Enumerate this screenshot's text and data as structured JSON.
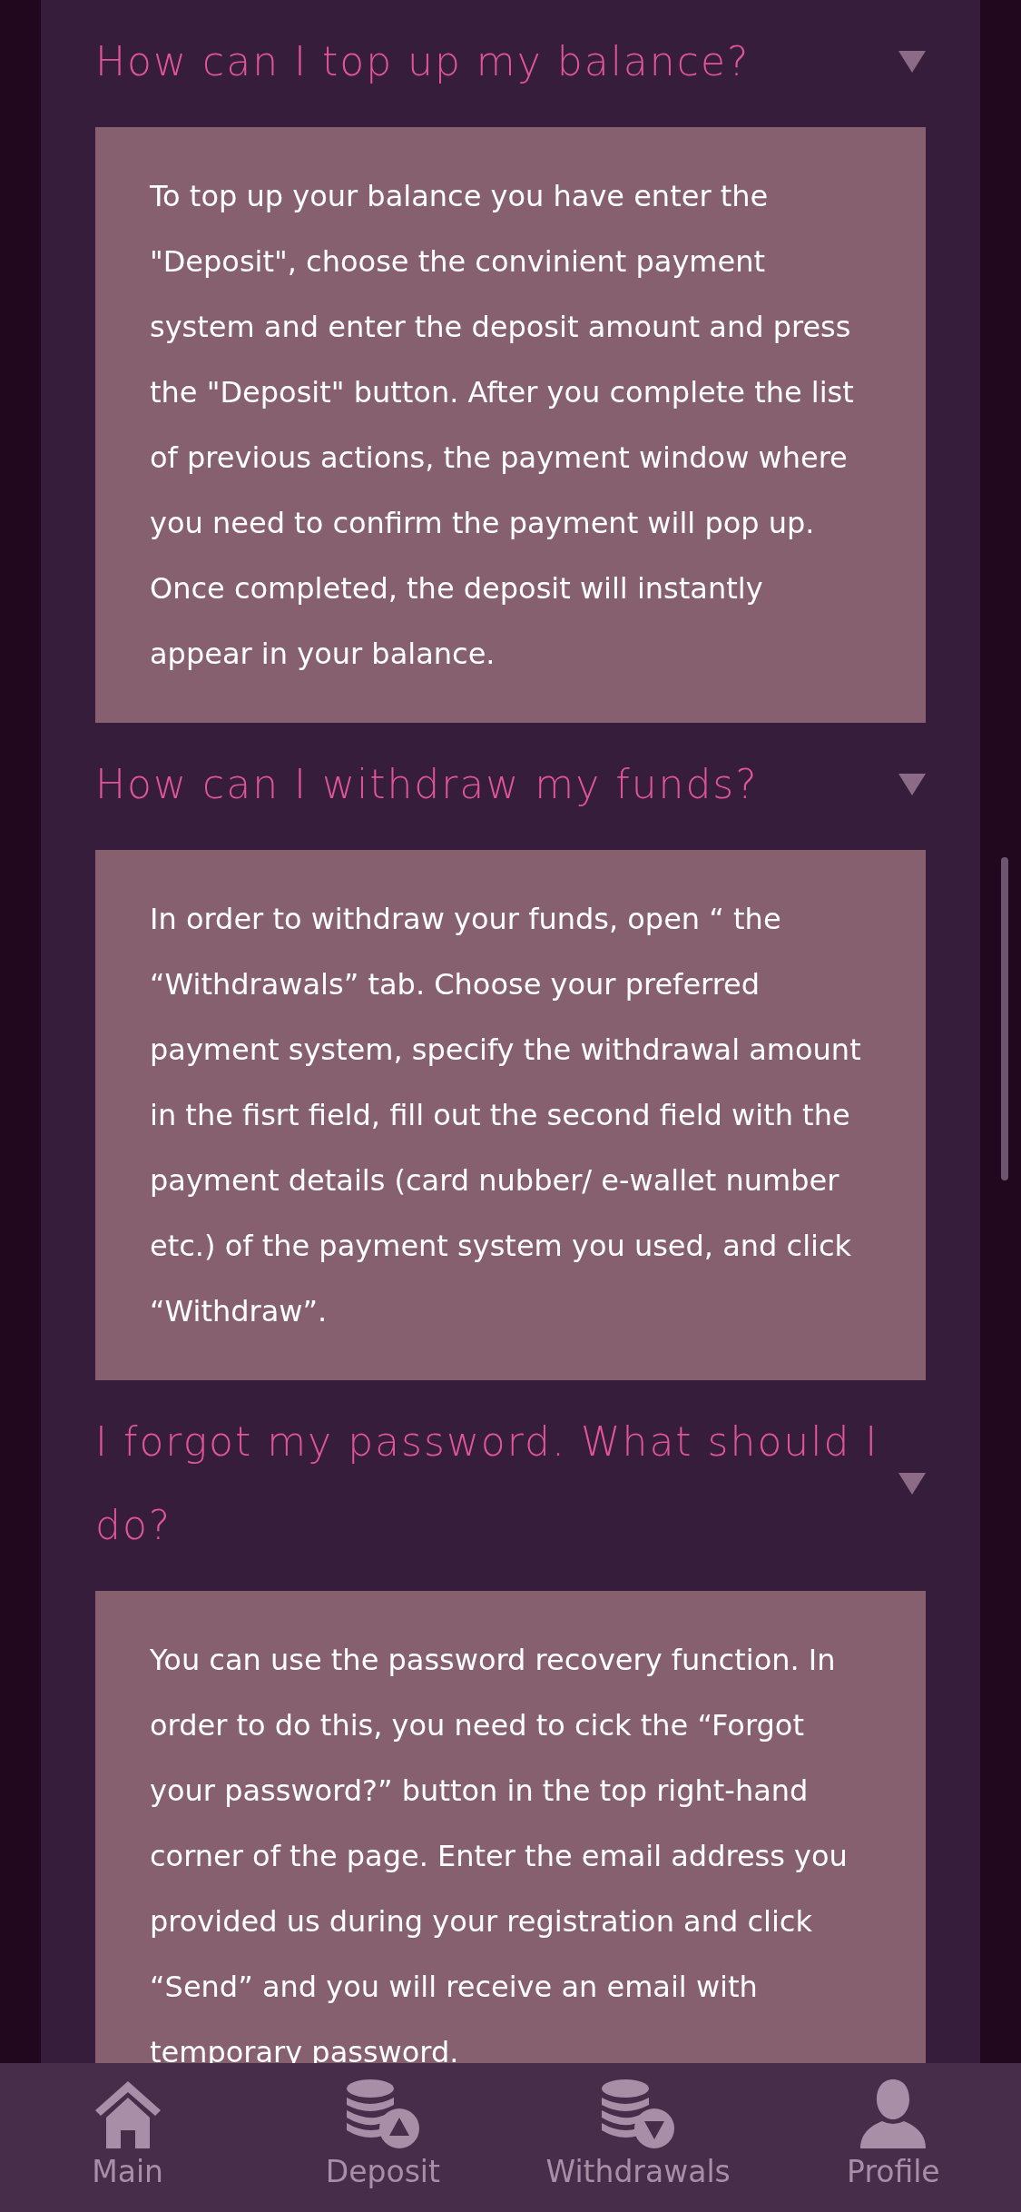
{
  "faq": [
    {
      "question": "How can I top up my balance?",
      "expanded": true,
      "answer": "To top up your balance you have enter the \"Deposit\", choose the convinient payment system and enter the deposit amount and press the \"Deposit\" button. After you complete the list of previous actions, the payment window where you need to confirm the payment will pop up. Once completed, the deposit will instantly appear in your balance."
    },
    {
      "question": "How can I withdraw my funds?",
      "expanded": true,
      "answer": "In order to withdraw your funds, open “ the “Withdrawals” tab. Choose your preferred payment system, specify the withdrawal amount in the fisrt field, fill out the second field with the payment details (card nubber/ e-wallet number etc.) of the payment system you used, and click “Withdraw”."
    },
    {
      "question": "I forgot my password. What should I do?",
      "expanded": true,
      "answer": "You can use the password recovery function. In order to do this, you need to cick the “Forgot your password?” button in the top right-hand corner of the page. Enter the email address you provided us during your registration and click “Send” and you will receive an email with temporary password."
    }
  ],
  "nav": [
    {
      "kind": "home",
      "label": "Main",
      "selected": false
    },
    {
      "kind": "deposit",
      "label": "Deposit",
      "selected": false
    },
    {
      "kind": "withdraw",
      "label": "Withdrawals",
      "selected": false
    },
    {
      "kind": "profile",
      "label": "Profile",
      "selected": false
    }
  ]
}
